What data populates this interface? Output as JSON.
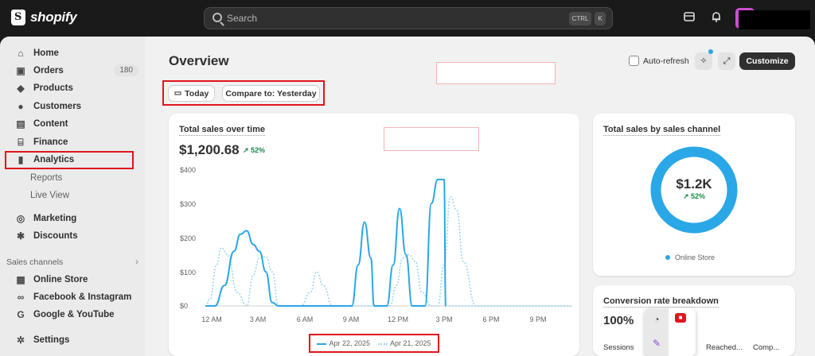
{
  "brand": {
    "name": "shopify"
  },
  "search": {
    "placeholder": "Search",
    "shortcut_mod": "CTRL",
    "shortcut_key": "K"
  },
  "icons": {
    "store": "store-icon",
    "bell": "bell-icon",
    "calendar": "calendar-icon",
    "sparkle": "sparkle-icon",
    "expand": "expand-icon"
  },
  "sidebar": {
    "items": [
      {
        "label": "Home",
        "icon": "home-icon"
      },
      {
        "label": "Orders",
        "icon": "orders-icon",
        "badge": "180"
      },
      {
        "label": "Products",
        "icon": "tag-icon"
      },
      {
        "label": "Customers",
        "icon": "person-icon"
      },
      {
        "label": "Content",
        "icon": "content-icon"
      },
      {
        "label": "Finance",
        "icon": "bank-icon"
      },
      {
        "label": "Analytics",
        "icon": "bar-chart-icon"
      },
      {
        "label": "Reports"
      },
      {
        "label": "Live View"
      },
      {
        "label": "Marketing",
        "icon": "target-icon"
      },
      {
        "label": "Discounts",
        "icon": "discount-icon"
      }
    ],
    "channels_label": "Sales channels",
    "channels": [
      {
        "label": "Online Store",
        "icon": "storefront-icon"
      },
      {
        "label": "Facebook & Instagram",
        "icon": "meta-icon"
      },
      {
        "label": "Google & YouTube",
        "icon": "google-icon"
      }
    ],
    "settings_label": "Settings"
  },
  "main": {
    "title": "Overview",
    "today_label": "Today",
    "compare_label": "Compare to: Yesterday",
    "auto_refresh_label": "Auto-refresh",
    "customize_label": "Customize",
    "accent": "#2aa7e6"
  },
  "sales_card": {
    "title": "Total sales over time",
    "value": "$1,200.68",
    "delta": "↗ 52%",
    "chart_data": {
      "type": "line",
      "yticks": [
        "$400",
        "$300",
        "$200",
        "$100",
        "$0"
      ],
      "ylim": [
        0,
        400
      ],
      "xticks": [
        "12 AM",
        "3 AM",
        "6 AM",
        "9 AM",
        "12 PM",
        "3 PM",
        "6 PM",
        "9 PM"
      ],
      "xlim": [
        0,
        23
      ],
      "series": [
        {
          "name": "Apr 22, 2025",
          "style": "solid",
          "x": [
            0,
            0.6,
            1.2,
            1.8,
            2.2,
            2.6,
            3.0,
            3.4,
            3.8,
            4.2,
            4.6,
            5.0,
            6,
            7,
            8,
            9,
            9.2,
            9.6,
            10.0,
            10.4,
            10.6,
            11.0,
            11.4,
            11.8,
            12.2,
            12.6,
            13.0,
            13.4,
            13.8,
            14.2,
            14.6,
            15.0,
            15.1
          ],
          "y": [
            0,
            0,
            60,
            160,
            210,
            220,
            180,
            160,
            100,
            10,
            0,
            0,
            0,
            0,
            0,
            0,
            0,
            120,
            245,
            140,
            0,
            0,
            0,
            120,
            285,
            150,
            0,
            0,
            0,
            300,
            370,
            370,
            0
          ]
        },
        {
          "name": "Apr 21, 2025",
          "style": "dotted",
          "x": [
            0,
            0.3,
            0.7,
            1.0,
            1.4,
            2.0,
            2.6,
            3.0,
            3.4,
            3.8,
            4.2,
            4.6,
            5.0,
            6.0,
            6.6,
            7.0,
            7.4,
            8.0,
            9,
            10,
            11,
            11.6,
            12.0,
            12.4,
            12.8,
            13.2,
            13.6,
            14.2,
            14.6,
            15.0,
            15.4,
            15.8,
            16.2,
            17,
            18,
            23
          ],
          "y": [
            0,
            20,
            120,
            170,
            150,
            40,
            0,
            90,
            140,
            145,
            100,
            0,
            0,
            0,
            40,
            100,
            60,
            0,
            0,
            0,
            0,
            0,
            60,
            140,
            150,
            130,
            40,
            0,
            0,
            120,
            320,
            280,
            130,
            0,
            0,
            0
          ]
        }
      ],
      "legend": "bottom"
    }
  },
  "channel_card": {
    "title": "Total sales by sales channel",
    "value": "$1.2K",
    "delta": "↗ 52%",
    "legend_label": "Online Store"
  },
  "conversion_card": {
    "title": "Conversion rate breakdown",
    "value": "100%",
    "columns": [
      "Sessions",
      "Reached...",
      "Comp..."
    ]
  }
}
